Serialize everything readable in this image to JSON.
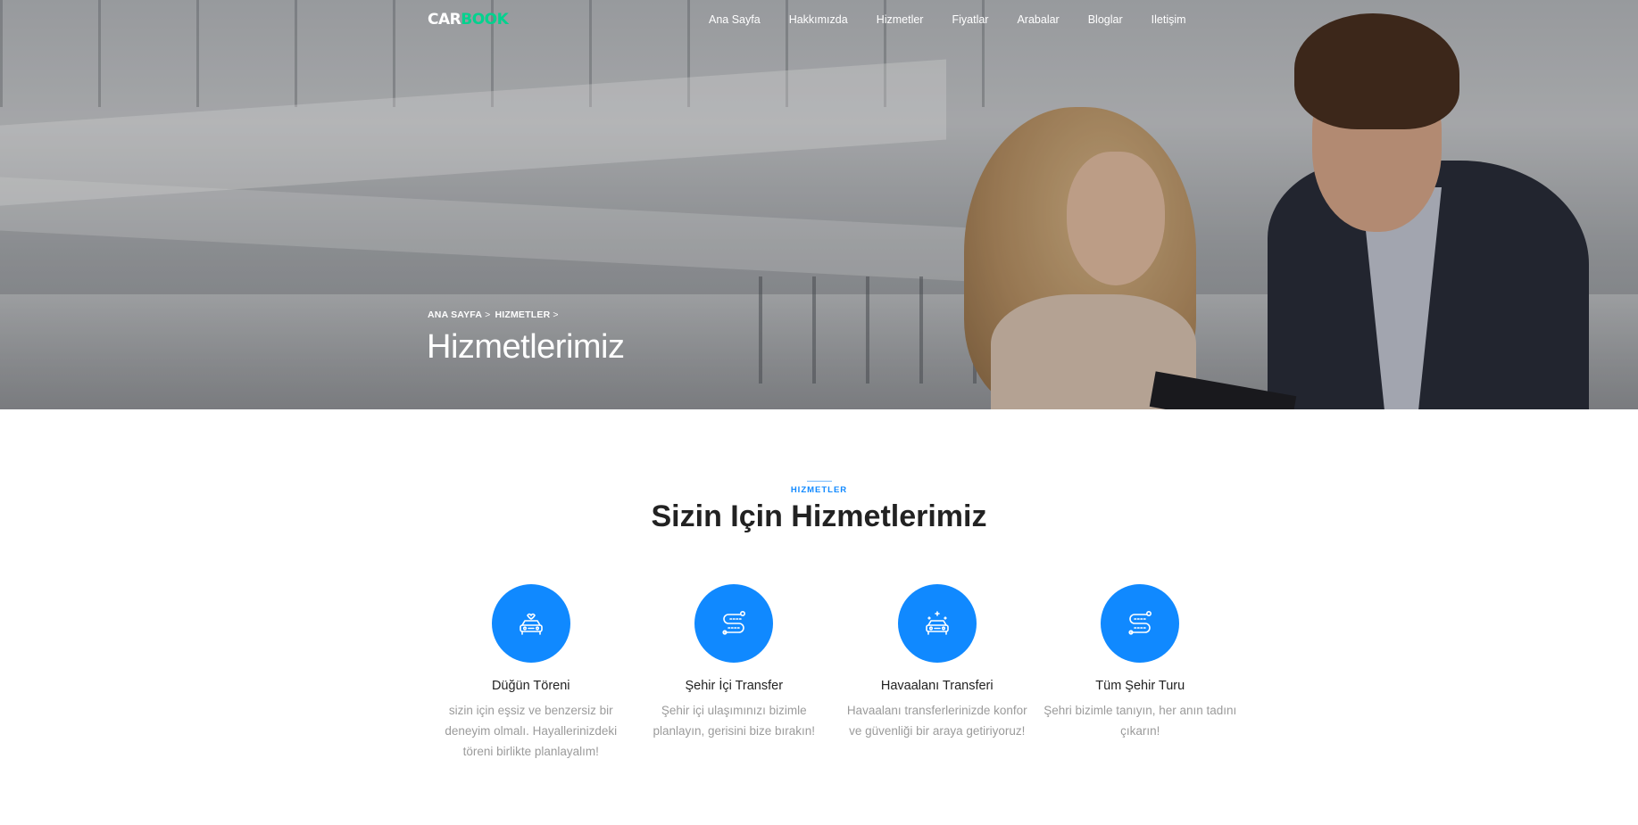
{
  "brand": {
    "part1": "CAR",
    "part2": "BOOK"
  },
  "nav": {
    "items": [
      {
        "label": "Ana Sayfa"
      },
      {
        "label": "Hakkımızda"
      },
      {
        "label": "Hizmetler"
      },
      {
        "label": "Fiyatlar"
      },
      {
        "label": "Arabalar"
      },
      {
        "label": "Bloglar"
      },
      {
        "label": "Iletişim"
      }
    ]
  },
  "hero": {
    "breadcrumb": {
      "home": "ANA SAYFA",
      "current": "HIZMETLER",
      "separator": ">"
    },
    "title": "Hizmetlerimiz"
  },
  "services_section": {
    "subheading": "HIZMETLER",
    "title": "Sizin Için Hizmetlerimiz",
    "items": [
      {
        "icon": "wedding-car-icon",
        "title": "Düğün Töreni",
        "description": "sizin için eşsiz ve benzersiz bir deneyim olmalı. Hayallerinizdeki töreni birlikte planlayalım!"
      },
      {
        "icon": "route-icon",
        "title": "Şehir İçi Transfer",
        "description": "Şehir içi ulaşımınızı bizimle planlayın, gerisini bize bırakın!"
      },
      {
        "icon": "car-sparkle-icon",
        "title": "Havaalanı Transferi",
        "description": "Havaalanı transferlerinizde konfor ve güvenliği bir araya getiriyoruz!"
      },
      {
        "icon": "route-icon",
        "title": "Tüm Şehir Turu",
        "description": "Şehri bizimle tanıyın, her anın tadını çıkarın!"
      }
    ]
  },
  "colors": {
    "accent": "#1089ff",
    "brand_green": "#01d28e",
    "heading": "#222222",
    "body_text": "#9b9b9b"
  }
}
